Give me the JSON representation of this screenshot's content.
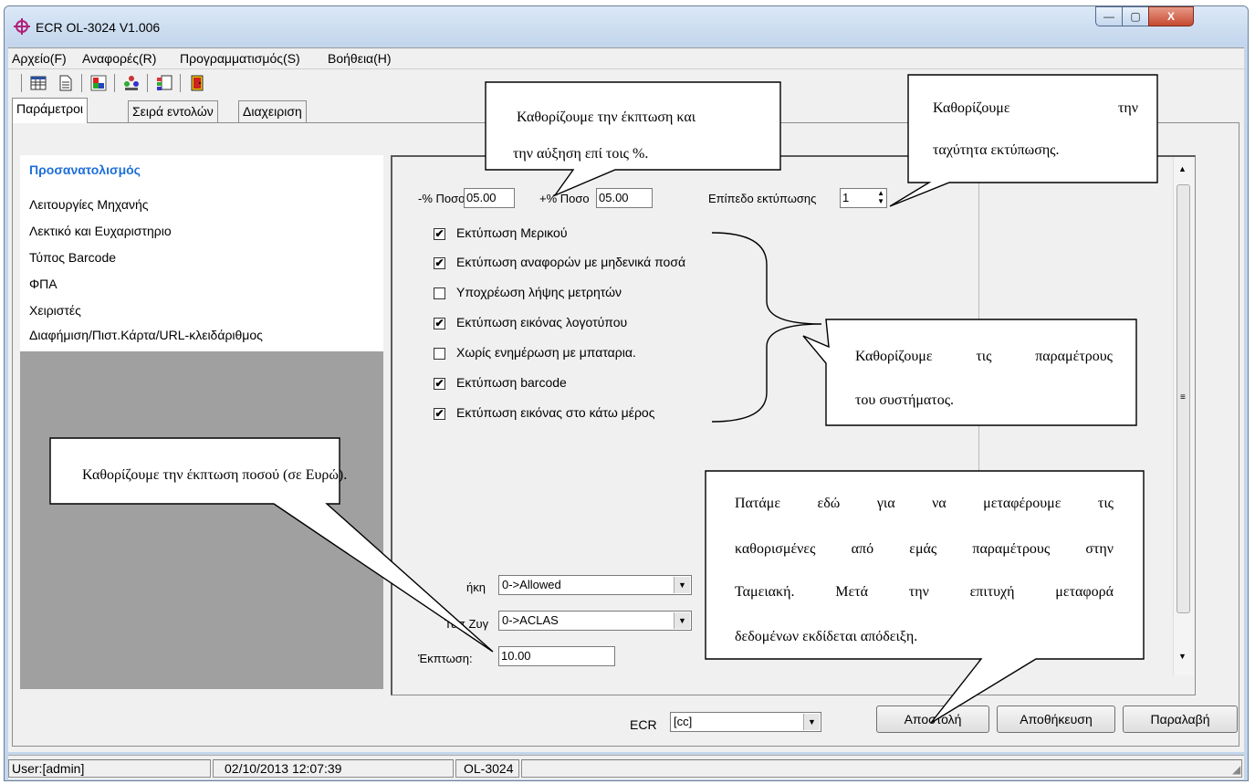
{
  "window": {
    "title": "ECR OL-3024 V1.006",
    "controls": {
      "minimize": "—",
      "maximize": "▢",
      "close": "X"
    }
  },
  "menu": [
    "Αρχείο(F)",
    "Αναφορές(R)",
    "Προγραμματισμός(S)",
    "Βοήθεια(H)"
  ],
  "toolbar_icons": [
    "table-icon",
    "document-icon",
    "chart-icon",
    "users-icon",
    "report-icon",
    "exit-icon"
  ],
  "tabs": [
    "Παράμετροι",
    "Σειρά εντολών",
    "Διαχειριση"
  ],
  "nav": {
    "header": "Προσανατολισμός",
    "items": [
      "Λειτουργίες Μηχανής",
      "Λεκτικό και Ευχαριστηριο",
      "Τύπος Barcode",
      "ΦΠΑ",
      "Χειριστές",
      "Διαφήμιση/Πιστ.Κάρτα/URL-κλειδάριθμος"
    ]
  },
  "form": {
    "minus_pct_label": "-% Ποσο",
    "minus_pct_value": "05.00",
    "plus_pct_label": "+% Ποσο",
    "plus_pct_value": "05.00",
    "print_level_label": "Επίπεδο εκτύπωσης",
    "print_level_value": "1",
    "checkboxes": [
      {
        "label": "Εκτύπωση Μερικού",
        "checked": true,
        "mark": "✔"
      },
      {
        "label": "Εκτύπωση αναφορών με μηδενικά ποσά",
        "checked": true,
        "mark": "✔"
      },
      {
        "label": "Υποχρέωση λήψης μετρητών",
        "checked": false,
        "mark": ""
      },
      {
        "label": "Εκτύπωση εικόνας λογοτύπου",
        "checked": true,
        "mark": "✔"
      },
      {
        "label": "Χωρίς ενημέρωση με μπαταρια.",
        "checked": false,
        "mark": ""
      },
      {
        "label": "Εκτύπωση barcode",
        "checked": true,
        "mark": "✔"
      },
      {
        "label": "Εκτύπωση εικόνας στο κάτω μέρος",
        "checked": true,
        "mark": "✔"
      }
    ],
    "combo1_label": "ήκη",
    "combo1_value": "0->Allowed",
    "combo2_label": "Τυπ   Ζυγ",
    "combo2_value": "0->ACLAS",
    "discount_label": "Έκπτωση:",
    "discount_value": "10.00"
  },
  "bottom": {
    "ecr_label": "ECR",
    "ecr_value": "[cc]",
    "buttons": [
      "Αποστολή",
      "Αποθήκευση",
      "Παραλαβή"
    ]
  },
  "status": {
    "user": "User:[admin]",
    "datetime": "02/10/2013 12:07:39",
    "model": "OL-3024"
  },
  "callouts": {
    "c1_line1": "Καθορίζουμε την έκπτωση και",
    "c1_line2": "την αύξηση  επί τοις %.",
    "c2_word1": "Καθορίζουμε",
    "c2_word2": "την",
    "c2_line2": "ταχύτητα εκτύπωσης.",
    "c3_line1": "Καθορίζουμε τις  παραμέτρους",
    "c3_line2": "του συστήματος.",
    "c4_line1": "Καθορίζουμε την έκπτωση ποσού (σε Ευρώ).",
    "c5_line1": "Πατάμε εδώ για να μεταφέρουμε τις",
    "c5_line2": "καθορισμένες από εμάς παραμέτρους στην",
    "c5_line3": "Ταμειακή. Μετά την επιτυχή μεταφορά",
    "c5_line4": "δεδομένων εκδίδεται απόδειξη."
  }
}
